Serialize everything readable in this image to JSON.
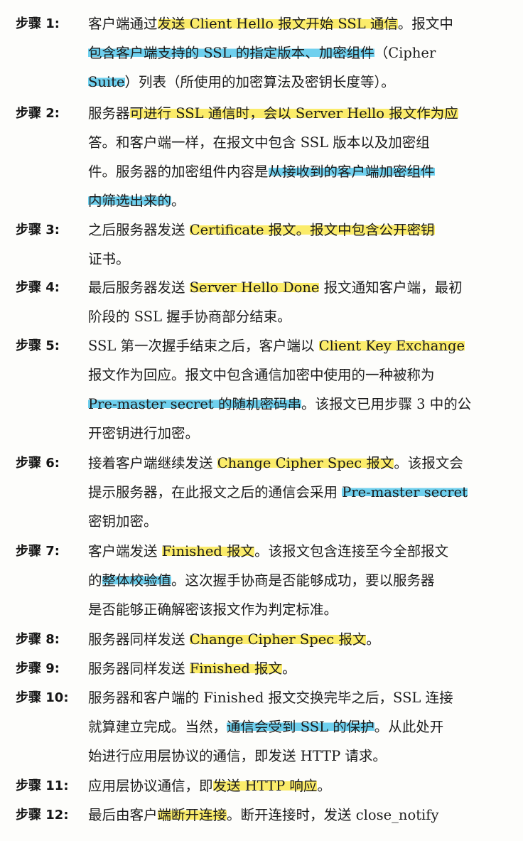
{
  "steps": [
    {
      "label": "步骤 1:",
      "lines": [
        [
          [
            "客户端通过",
            ""
          ],
          [
            "发送 Client Hello 报文开始 SSL 通信",
            "y"
          ],
          [
            "。报文中",
            ""
          ]
        ],
        [
          [
            "包含客户端支持的 SSL 的指定版本、加密组件",
            "b"
          ],
          [
            "（Cipher",
            ""
          ]
        ],
        [
          [
            "Suite",
            "b"
          ],
          [
            "）列表（所使用的加密算法及密钥长度等）。",
            ""
          ]
        ]
      ]
    },
    {
      "label": "步骤 2:",
      "lines": [
        [
          [
            "服务器",
            ""
          ],
          [
            "可进行 SSL 通信时，会以 Server Hello 报文作为应",
            "y"
          ]
        ],
        [
          [
            "答。和客户端一样，在报文中包含 SSL 版本以及加密组",
            ""
          ]
        ],
        [
          [
            "件。服务器的加密组件内容是",
            ""
          ],
          [
            "从接收到的客户端加密组件",
            "b"
          ]
        ],
        [
          [
            "内筛选出来的",
            "b"
          ],
          [
            "。",
            ""
          ]
        ]
      ]
    },
    {
      "label": "步骤 3:",
      "lines": [
        [
          [
            "之后服务器发送 ",
            ""
          ],
          [
            "Certificate 报文。报文中包含公开密钥",
            "y"
          ]
        ],
        [
          [
            "证书。",
            ""
          ]
        ]
      ]
    },
    {
      "label": "步骤 4:",
      "lines": [
        [
          [
            "最后服务器发送 ",
            ""
          ],
          [
            "Server Hello Done",
            "y"
          ],
          [
            " 报文通知客户端，最初",
            ""
          ]
        ],
        [
          [
            "阶段的 SSL 握手协商部分结束。",
            ""
          ]
        ]
      ]
    },
    {
      "label": "步骤 5:",
      "lines": [
        [
          [
            "SSL 第一次握手结束之后，客户端以 ",
            ""
          ],
          [
            "Client Key Exchange",
            "y"
          ]
        ],
        [
          [
            "报文作为回应。报文中包含通信加密中使用的一种被称为",
            ""
          ]
        ],
        [
          [
            "Pre-master secret 的随机密码串",
            "b"
          ],
          [
            "。该报文已用步骤 3 中的公",
            ""
          ]
        ],
        [
          [
            "开密钥进行加密。",
            ""
          ]
        ]
      ]
    },
    {
      "label": "步骤 6:",
      "lines": [
        [
          [
            "接着客户端继续发送 ",
            ""
          ],
          [
            "Change Cipher Spec 报文",
            "y"
          ],
          [
            "。该报文会",
            ""
          ]
        ],
        [
          [
            "提示服务器，在此报文之后的通信会采用 ",
            ""
          ],
          [
            "Pre-master secret",
            "b"
          ]
        ],
        [
          [
            "密钥加密。",
            ""
          ]
        ]
      ]
    },
    {
      "label": "步骤 7:",
      "lines": [
        [
          [
            "客户端发送 ",
            ""
          ],
          [
            "Finished 报文",
            "y"
          ],
          [
            "。该报文包含连接至今全部报文",
            ""
          ]
        ],
        [
          [
            "的",
            ""
          ],
          [
            "整体校验值",
            "b"
          ],
          [
            "。这次握手协商是否能够成功，要以服务器",
            ""
          ]
        ],
        [
          [
            "是否能够正确解密该报文作为判定标准。",
            ""
          ]
        ]
      ]
    },
    {
      "label": "步骤 8:",
      "lines": [
        [
          [
            "服务器同样发送 ",
            ""
          ],
          [
            "Change Cipher Spec 报文",
            "y"
          ],
          [
            "。",
            ""
          ]
        ]
      ]
    },
    {
      "label": "步骤 9:",
      "lines": [
        [
          [
            "服务器同样发送 ",
            ""
          ],
          [
            "Finished 报文",
            "y"
          ],
          [
            "。",
            ""
          ]
        ]
      ]
    },
    {
      "label": "步骤 10:",
      "lines": [
        [
          [
            "服务器和客户端的 Finished 报文交换完毕之后，SSL 连接",
            ""
          ]
        ],
        [
          [
            "就算建立完成。当然，",
            ""
          ],
          [
            "通信会受到 SSL 的保护",
            "b"
          ],
          [
            "。从此处开",
            ""
          ]
        ],
        [
          [
            "始进行应用层协议的通信，即发送 HTTP 请求。",
            ""
          ]
        ]
      ]
    },
    {
      "label": "步骤 11:",
      "lines": [
        [
          [
            "应用层协议通信，即",
            ""
          ],
          [
            "发送 HTTP 响应",
            "y"
          ],
          [
            "。",
            ""
          ]
        ]
      ]
    },
    {
      "label": "步骤 12:",
      "lines": [
        [
          [
            "最后由客户",
            ""
          ],
          [
            "端断开连接",
            "y"
          ],
          [
            "。断开连接时，发送 close_notify",
            ""
          ]
        ]
      ]
    }
  ]
}
